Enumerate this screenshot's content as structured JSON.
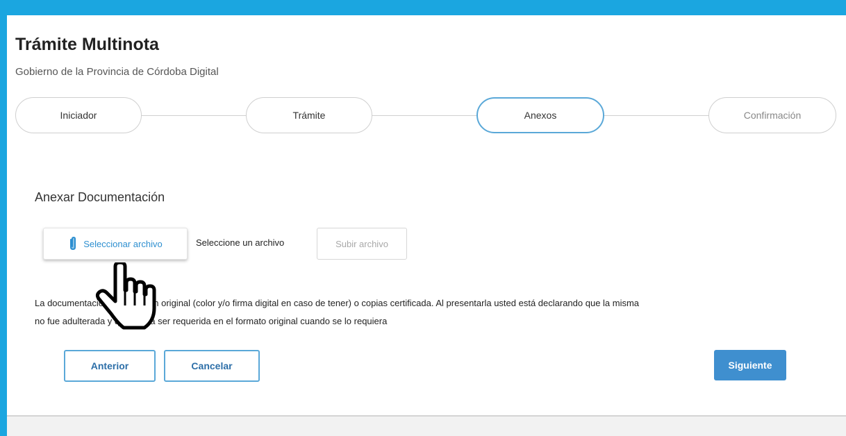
{
  "header": {
    "title": "Trámite Multinota",
    "subtitle": "Gobierno de la Provincia de Córdoba Digital"
  },
  "steps": [
    {
      "label": "Iniciador",
      "state": "done"
    },
    {
      "label": "Trámite",
      "state": "done"
    },
    {
      "label": "Anexos",
      "state": "active"
    },
    {
      "label": "Confirmación",
      "state": "pending"
    }
  ],
  "attachments": {
    "section_title": "Anexar Documentación",
    "select_button_label": "Seleccionar archivo",
    "select_button_icon": "paperclip-icon",
    "file_status": "Seleccione un archivo",
    "upload_button_label": "Subir archivo"
  },
  "notice": {
    "line1": "La documentación debe ser en original (color y/o firma digital en caso de tener) o copias certificada. Al presentarla usted está declarando que la misma",
    "line2": "no fue adulterada y que podrá ser requerida en el formato original cuando se lo requiera"
  },
  "navigation": {
    "previous_label": "Anterior",
    "cancel_label": "Cancelar",
    "next_label": "Siguiente"
  },
  "colors": {
    "frame": "#1ba6e0",
    "accent": "#3f8fcf",
    "active_step_border": "#5aa8d8"
  },
  "cursor": {
    "icon": "hand-pointer-icon"
  }
}
